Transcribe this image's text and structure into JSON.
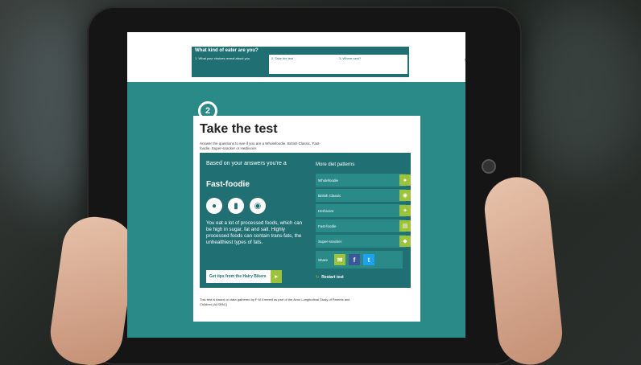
{
  "header": {
    "title": "What kind of eater are you?",
    "steps": [
      {
        "label": "1. What your choices reveal about you"
      },
      {
        "label": "2. Take the test"
      },
      {
        "label": "3. Where next?"
      }
    ],
    "share_icon": "share-icon"
  },
  "badge": {
    "number": "2"
  },
  "card": {
    "title": "Take the test",
    "intro": "Answer the questions to see if you are a Wholefoodie, British Classic, Fast-foodie, Super-snacker or Herbivore.",
    "result": {
      "based_on": "Based on your answers you're a",
      "type": "Fast-foodie",
      "food_icons": [
        "burger-icon",
        "fries-icon",
        "pizza-icon"
      ],
      "description": "You eat a lot of processed foods, which can be high in sugar, fat and salt. Highly processed foods can contain trans-fats, the unhealthiest types of fats.",
      "tips_label": "Get tips from the Hairy Bikers"
    },
    "patterns": {
      "heading": "More diet patterns",
      "items": [
        {
          "label": "Wholefoodie",
          "icon": "apple-icon"
        },
        {
          "label": "British Classic",
          "icon": "teapot-icon"
        },
        {
          "label": "Herbivore",
          "icon": "leaf-icon"
        },
        {
          "label": "Fast-foodie",
          "icon": "burger-icon"
        },
        {
          "label": "Super-snacker",
          "icon": "snack-icon"
        }
      ],
      "share_label": "Share",
      "restart_label": "Restart test"
    },
    "footnote": "This test is based on data gathered by P M Emmett as part of the Avon Longitudinal Study of Parents and Children (ALSPAC)"
  },
  "colors": {
    "teal_dark": "#1f6f73",
    "teal": "#2a8a88",
    "accent_green": "#9dc33b",
    "facebook": "#3b5998",
    "twitter": "#1da1f2"
  }
}
